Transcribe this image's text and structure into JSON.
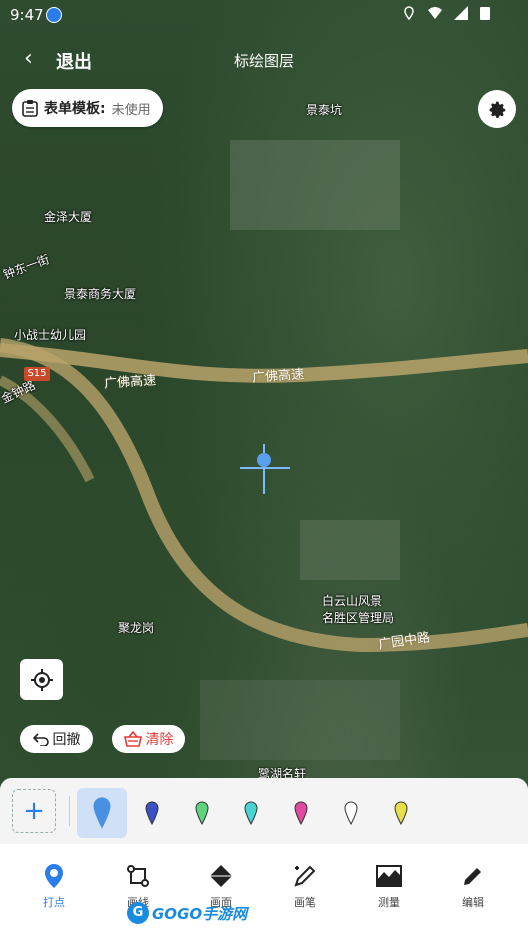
{
  "status": {
    "time": "9:47"
  },
  "header": {
    "exit_label": "退出",
    "title": "标绘图层"
  },
  "form_template": {
    "label": "表单模板:",
    "value": "未使用"
  },
  "map": {
    "labels": [
      "景泰坑",
      "金泽大厦",
      "钟东一街",
      "景泰商务大厦",
      "小战士幼儿园",
      "金钟路",
      "白云山风景",
      "名胜区管理局",
      "聚龙岗",
      "鹭湖名轩"
    ],
    "roads": [
      "广佛高速",
      "广佛高速",
      "广园中路"
    ],
    "shield": "S15"
  },
  "actions": {
    "undo_label": "回撤",
    "clear_label": "清除"
  },
  "palette": {
    "colors": [
      "#4a90e2",
      "#3a4fc8",
      "#5fd47a",
      "#4ad4d4",
      "#e04aa0",
      "#ffffff",
      "#e8e04a"
    ]
  },
  "tabs": [
    {
      "label": "打点",
      "icon": "location-pin-icon",
      "active": true
    },
    {
      "label": "画线",
      "icon": "polyline-icon",
      "active": false
    },
    {
      "label": "画面",
      "icon": "polygon-icon",
      "active": false
    },
    {
      "label": "画笔",
      "icon": "pen-icon",
      "active": false
    },
    {
      "label": "测量",
      "icon": "measure-icon",
      "active": false
    },
    {
      "label": "编辑",
      "icon": "edit-icon",
      "active": false
    }
  ],
  "watermark": {
    "text": "GOGO手游网"
  },
  "colors": {
    "accent": "#2b7de9",
    "danger": "#e53935"
  }
}
